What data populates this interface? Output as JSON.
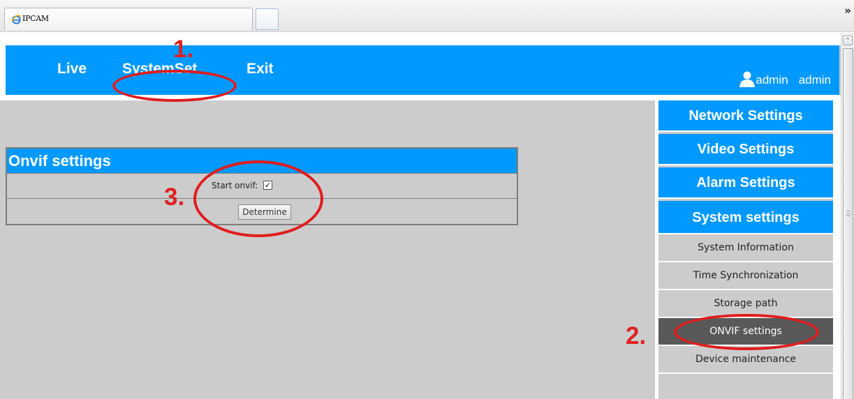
{
  "browser": {
    "tab_title": "IPCAM",
    "more_chevron": "»",
    "scroll_up_glyph": "^"
  },
  "header": {
    "nav": {
      "live": "Live",
      "systemset": "SystemSet",
      "exit": "Exit"
    },
    "user": {
      "name": "admin",
      "role": "admin"
    }
  },
  "panel": {
    "title": "Onvif settings",
    "start_label": "Start onvif:",
    "checkbox_mark": "✓",
    "determine_button": "Determine"
  },
  "sidebar": {
    "sections": {
      "network": "Network Settings",
      "video": "Video Settings",
      "alarm": "Alarm Settings",
      "system": "System settings"
    },
    "items": {
      "system_information": "System Information",
      "time_sync": "Time Synchronization",
      "storage_path": "Storage path",
      "onvif": "ONVIF settings",
      "device_maintenance": "Device maintenance"
    }
  },
  "annotations": {
    "step1": "1.",
    "step2": "2.",
    "step3": "3."
  },
  "colors": {
    "accent": "#0099ff",
    "background": "#cccccc",
    "active_item": "#595959",
    "annotation": "#e02020"
  }
}
